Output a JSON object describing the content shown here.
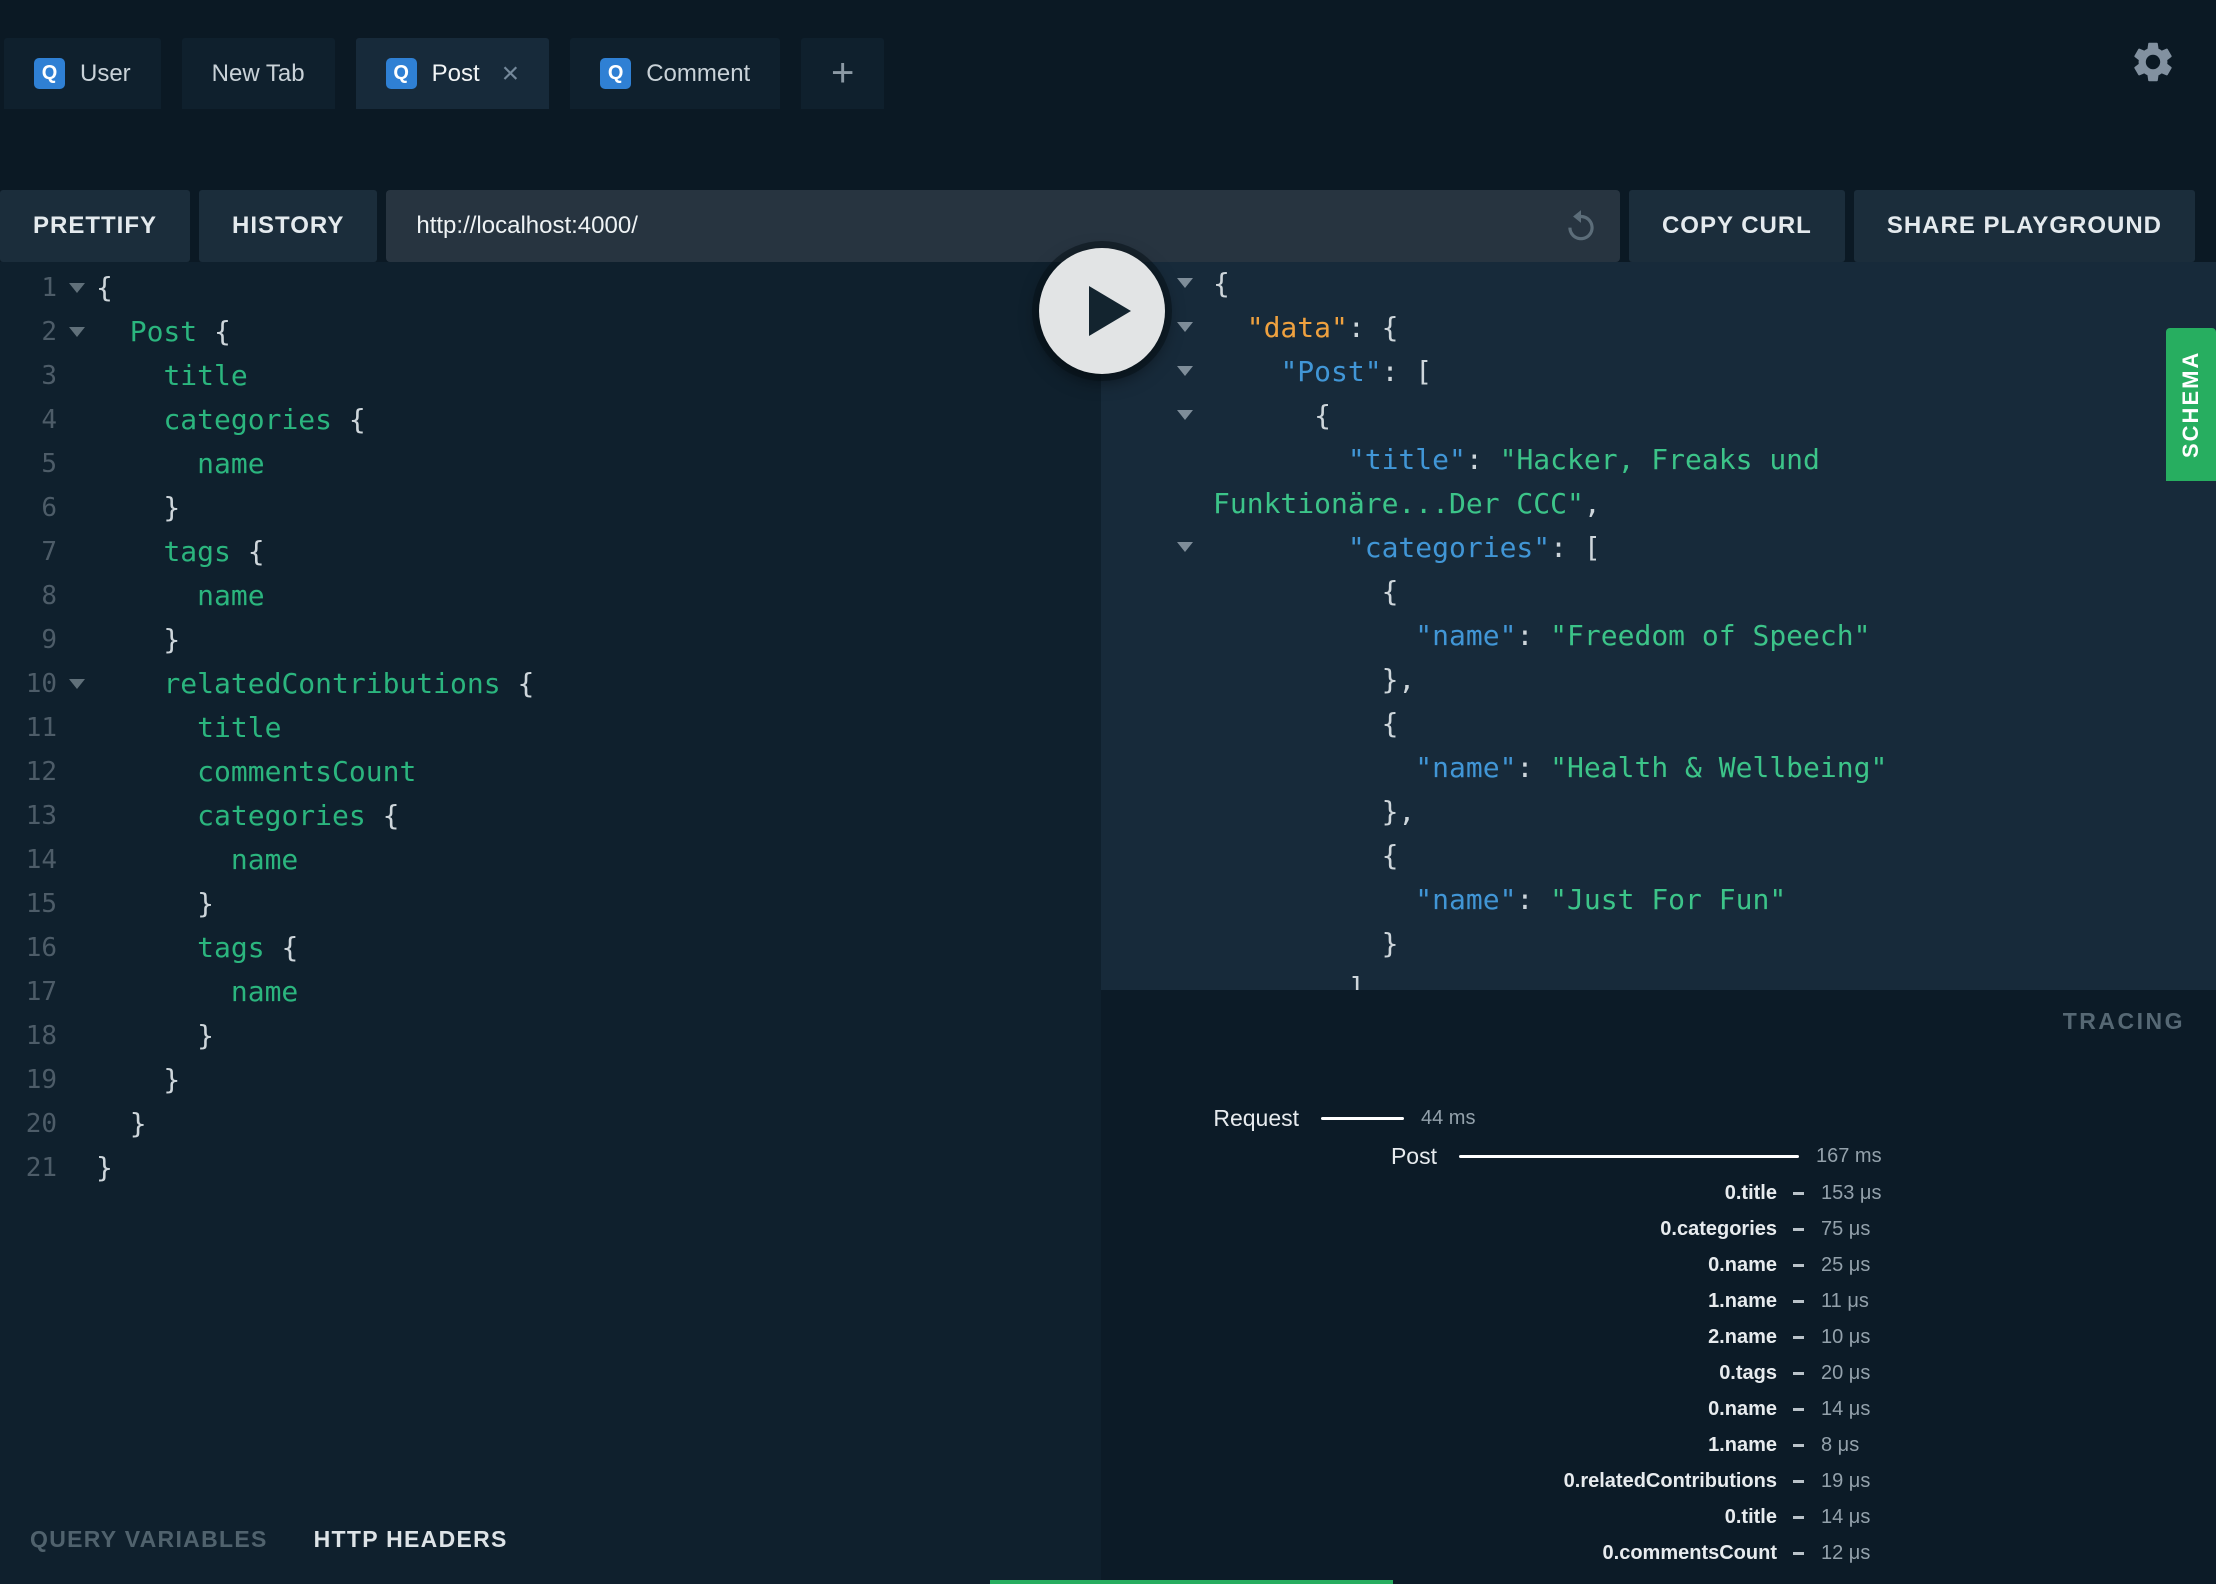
{
  "colors": {
    "brand_green": "#27ae60",
    "tab_icon_blue": "#2f80d4",
    "query_field_green": "#2bb57e",
    "result_key_blue": "#4196d6",
    "result_data_key_orange": "#efa13f",
    "result_string_green": "#3cc489"
  },
  "tabs": {
    "icon_letter": "Q",
    "add_label": "+",
    "items": [
      {
        "label": "User",
        "has_icon": true,
        "active": false,
        "closable": false
      },
      {
        "label": "New Tab",
        "has_icon": false,
        "active": false,
        "closable": false
      },
      {
        "label": "Post",
        "has_icon": true,
        "active": true,
        "closable": true
      },
      {
        "label": "Comment",
        "has_icon": true,
        "active": false,
        "closable": false
      }
    ]
  },
  "toolbar": {
    "prettify_label": "PRETTIFY",
    "history_label": "HISTORY",
    "url_value": "http://localhost:4000/",
    "copy_curl_label": "COPY CURL",
    "share_label": "SHARE PLAYGROUND"
  },
  "editor": {
    "lines": [
      {
        "n": 1,
        "fold": true,
        "t": [
          [
            "p",
            "{"
          ]
        ]
      },
      {
        "n": 2,
        "fold": true,
        "t": [
          [
            "p",
            "  "
          ],
          [
            "f",
            "Post"
          ],
          [
            "p",
            " {"
          ]
        ]
      },
      {
        "n": 3,
        "t": [
          [
            "p",
            "    "
          ],
          [
            "f",
            "title"
          ]
        ]
      },
      {
        "n": 4,
        "t": [
          [
            "p",
            "    "
          ],
          [
            "f",
            "categories"
          ],
          [
            "p",
            " {"
          ]
        ]
      },
      {
        "n": 5,
        "t": [
          [
            "p",
            "      "
          ],
          [
            "f",
            "name"
          ]
        ]
      },
      {
        "n": 6,
        "t": [
          [
            "p",
            "    }"
          ]
        ]
      },
      {
        "n": 7,
        "t": [
          [
            "p",
            "    "
          ],
          [
            "f",
            "tags"
          ],
          [
            "p",
            " {"
          ]
        ]
      },
      {
        "n": 8,
        "t": [
          [
            "p",
            "      "
          ],
          [
            "f",
            "name"
          ]
        ]
      },
      {
        "n": 9,
        "t": [
          [
            "p",
            "    }"
          ]
        ]
      },
      {
        "n": 10,
        "fold": true,
        "t": [
          [
            "p",
            "    "
          ],
          [
            "f",
            "relatedContributions"
          ],
          [
            "p",
            " {"
          ]
        ]
      },
      {
        "n": 11,
        "t": [
          [
            "p",
            "      "
          ],
          [
            "f",
            "title"
          ]
        ]
      },
      {
        "n": 12,
        "t": [
          [
            "p",
            "      "
          ],
          [
            "f",
            "commentsCount"
          ]
        ]
      },
      {
        "n": 13,
        "t": [
          [
            "p",
            "      "
          ],
          [
            "f",
            "categories"
          ],
          [
            "p",
            " {"
          ]
        ]
      },
      {
        "n": 14,
        "t": [
          [
            "p",
            "        "
          ],
          [
            "f",
            "name"
          ]
        ]
      },
      {
        "n": 15,
        "t": [
          [
            "p",
            "      }"
          ]
        ]
      },
      {
        "n": 16,
        "t": [
          [
            "p",
            "      "
          ],
          [
            "f",
            "tags"
          ],
          [
            "p",
            " {"
          ]
        ]
      },
      {
        "n": 17,
        "t": [
          [
            "p",
            "        "
          ],
          [
            "f",
            "name"
          ]
        ]
      },
      {
        "n": 18,
        "t": [
          [
            "p",
            "      }"
          ]
        ]
      },
      {
        "n": 19,
        "t": [
          [
            "p",
            "    }"
          ]
        ]
      },
      {
        "n": 20,
        "t": [
          [
            "p",
            "  }"
          ]
        ]
      },
      {
        "n": 21,
        "t": [
          [
            "p",
            "}"
          ]
        ]
      }
    ]
  },
  "result": {
    "lines": [
      {
        "c": true,
        "t": [
          [
            "p",
            "{"
          ]
        ]
      },
      {
        "c": true,
        "t": [
          [
            "p",
            "  "
          ],
          [
            "dkey",
            "\"data\""
          ],
          [
            "p",
            ": {"
          ]
        ]
      },
      {
        "c": true,
        "t": [
          [
            "p",
            "    "
          ],
          [
            "key",
            "\"Post\""
          ],
          [
            "p",
            ": ["
          ]
        ]
      },
      {
        "c": true,
        "t": [
          [
            "p",
            "      {"
          ]
        ]
      },
      {
        "t": [
          [
            "p",
            "        "
          ],
          [
            "key",
            "\"title\""
          ],
          [
            "p",
            ": "
          ],
          [
            "str",
            "\"Hacker, Freaks und"
          ]
        ]
      },
      {
        "t": [
          [
            "str",
            "Funktionäre...Der CCC\""
          ],
          [
            "p",
            ","
          ]
        ]
      },
      {
        "c": true,
        "t": [
          [
            "p",
            "        "
          ],
          [
            "key",
            "\"categories\""
          ],
          [
            "p",
            ": ["
          ]
        ]
      },
      {
        "t": [
          [
            "p",
            "          {"
          ]
        ]
      },
      {
        "t": [
          [
            "p",
            "            "
          ],
          [
            "key",
            "\"name\""
          ],
          [
            "p",
            ": "
          ],
          [
            "str",
            "\"Freedom of Speech\""
          ]
        ]
      },
      {
        "t": [
          [
            "p",
            "          },"
          ]
        ]
      },
      {
        "t": [
          [
            "p",
            "          {"
          ]
        ]
      },
      {
        "t": [
          [
            "p",
            "            "
          ],
          [
            "key",
            "\"name\""
          ],
          [
            "p",
            ": "
          ],
          [
            "str",
            "\"Health & Wellbeing\""
          ]
        ]
      },
      {
        "t": [
          [
            "p",
            "          },"
          ]
        ]
      },
      {
        "t": [
          [
            "p",
            "          {"
          ]
        ]
      },
      {
        "t": [
          [
            "p",
            "            "
          ],
          [
            "key",
            "\"name\""
          ],
          [
            "p",
            ": "
          ],
          [
            "str",
            "\"Just For Fun\""
          ]
        ]
      },
      {
        "t": [
          [
            "p",
            "          }"
          ]
        ]
      },
      {
        "t": [
          [
            "p",
            "        ]"
          ]
        ]
      }
    ]
  },
  "schema": {
    "label": "SCHEMA"
  },
  "bottom_bar": {
    "query_variables_label": "QUERY VARIABLES",
    "http_headers_label": "HTTP HEADERS"
  },
  "tracing": {
    "title": "TRACING",
    "spans": [
      {
        "label": "Request",
        "duration": "44 ms",
        "kind": "root",
        "bar": 83
      },
      {
        "label": "Post",
        "duration": "167 ms",
        "kind": "field",
        "bar": 340
      },
      {
        "label": "0.title",
        "duration": "153 μs",
        "kind": "leaf"
      },
      {
        "label": "0.categories",
        "duration": "75 μs",
        "kind": "leaf"
      },
      {
        "label": "0.name",
        "duration": "25 μs",
        "kind": "leaf"
      },
      {
        "label": "1.name",
        "duration": "11 μs",
        "kind": "leaf"
      },
      {
        "label": "2.name",
        "duration": "10 μs",
        "kind": "leaf"
      },
      {
        "label": "0.tags",
        "duration": "20 μs",
        "kind": "leaf"
      },
      {
        "label": "0.name",
        "duration": "14 μs",
        "kind": "leaf"
      },
      {
        "label": "1.name",
        "duration": "8 μs",
        "kind": "leaf"
      },
      {
        "label": "0.relatedContributions",
        "duration": "19 μs",
        "kind": "leaf"
      },
      {
        "label": "0.title",
        "duration": "14 μs",
        "kind": "leaf"
      },
      {
        "label": "0.commentsCount",
        "duration": "12 μs",
        "kind": "leaf"
      }
    ]
  }
}
